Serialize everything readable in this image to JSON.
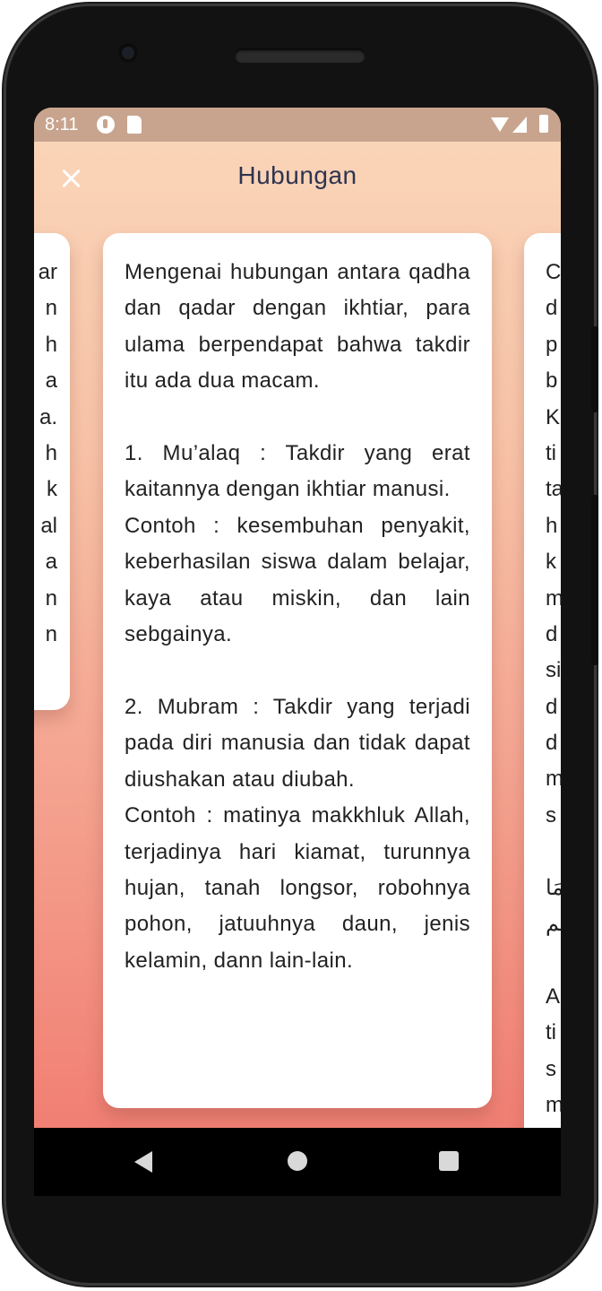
{
  "status_bar": {
    "time": "8:11"
  },
  "app_bar": {
    "title": "Hubungan",
    "close_icon": "close-icon"
  },
  "main_card": {
    "text": "Mengenai hubungan antara qadha dan qadar dengan ikhtiar, para ulama berpendapat bahwa takdir itu ada dua macam.\n\n1. Mu’alaq : Takdir yang erat kaitannya dengan ikhtiar manusi.\nContoh : kesembuhan penyakit, keberhasilan siswa dalam belajar, kaya atau miskin, dan lain sebgainya.\n\n2. Mubram : Takdir yang terjadi pada diri manusia dan tidak dapat diushakan atau diubah.\nContoh : matinya makkhluk Allah, terjadinya hari kiamat, turunnya hujan, tanah longsor, robohnya pohon, jatuuhnya daun, jenis kelamin, dann lain-lain."
  },
  "left_card_fragments": [
    "ar",
    "n",
    "h",
    "a",
    "a.",
    "h",
    "k",
    "al",
    "a",
    "n",
    "n"
  ],
  "right_card_fragments": [
    "C",
    "d",
    "p",
    "b",
    "K",
    "ti",
    "ta",
    "h",
    "k",
    "m",
    "d",
    "si",
    "d",
    "d",
    "m",
    "s",
    "",
    "مَا",
    "هم",
    "",
    "A",
    "ti",
    "s",
    "m"
  ],
  "nav_bar": {
    "back_icon": "back-triangle-icon",
    "home_icon": "home-circle-icon",
    "recent_icon": "recent-square-icon"
  }
}
